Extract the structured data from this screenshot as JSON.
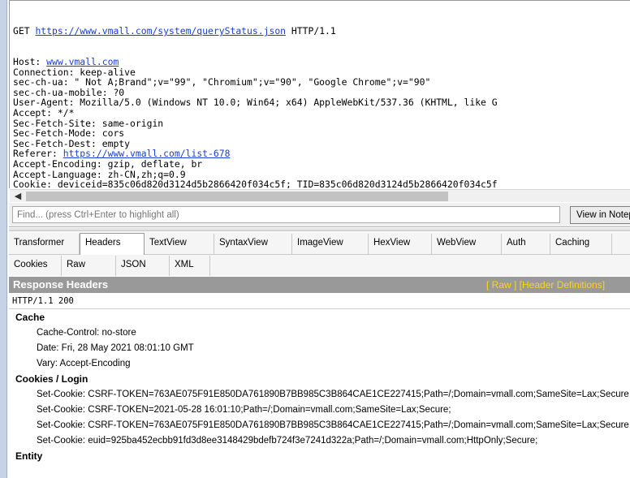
{
  "request": {
    "method": "GET",
    "url": "https://www.vmall.com/system/queryStatus.json",
    "protocol": "HTTP/1.1",
    "lines": [
      {
        "pre": "Host: ",
        "link": "www.vmall.com",
        "post": ""
      },
      {
        "pre": "Connection: keep-alive",
        "link": "",
        "post": ""
      },
      {
        "pre": "sec-ch-ua: \" Not A;Brand\";v=\"99\", \"Chromium\";v=\"90\", \"Google Chrome\";v=\"90\"",
        "link": "",
        "post": ""
      },
      {
        "pre": "sec-ch-ua-mobile: ?0",
        "link": "",
        "post": ""
      },
      {
        "pre": "User-Agent: Mozilla/5.0 (Windows NT 10.0; Win64; x64) AppleWebKit/537.36 (KHTML, like G",
        "link": "",
        "post": ""
      },
      {
        "pre": "Accept: */*",
        "link": "",
        "post": ""
      },
      {
        "pre": "Sec-Fetch-Site: same-origin",
        "link": "",
        "post": ""
      },
      {
        "pre": "Sec-Fetch-Mode: cors",
        "link": "",
        "post": ""
      },
      {
        "pre": "Sec-Fetch-Dest: empty",
        "link": "",
        "post": ""
      },
      {
        "pre": "Referer: ",
        "link": "https://www.vmall.com/list-678",
        "post": ""
      },
      {
        "pre": "Accept-Encoding: gzip, deflate, br",
        "link": "",
        "post": ""
      },
      {
        "pre": "Accept-Language: zh-CN,zh;q=0.9",
        "link": "",
        "post": ""
      },
      {
        "pre": "Cookie: deviceid=835c06d820d3124d5b2866420f034c5f; TID=835c06d820d3124d5b2866420f034c5f",
        "link": "",
        "post": ""
      }
    ]
  },
  "find": {
    "placeholder": "Find... (press Ctrl+Enter to highlight all)",
    "view_button": "View in Notepad"
  },
  "tabs_row1": [
    "Transformer",
    "Headers",
    "TextView",
    "SyntaxView",
    "ImageView",
    "HexView",
    "WebView",
    "Auth",
    "Caching"
  ],
  "tabs_row2": [
    "Cookies",
    "Raw",
    "JSON",
    "XML"
  ],
  "active_tab": "Headers",
  "response": {
    "title": "Response Headers",
    "links": "[ Raw ]   [Header Definitions]",
    "status_line": "HTTP/1.1 200",
    "groups": [
      {
        "name": "Cache",
        "headers": [
          "Cache-Control: no-store",
          "Date: Fri, 28 May 2021 08:01:10 GMT",
          "Vary: Accept-Encoding"
        ]
      },
      {
        "name": "Cookies / Login",
        "headers": [
          "Set-Cookie: CSRF-TOKEN=763AE075F91E850DA761890B7BB985C3B864CAE1CE227415;Path=/;Domain=vmall.com;SameSite=Lax;Secure;",
          "Set-Cookie: CSRF-TOKEN=2021-05-28 16:01:10;Path=/;Domain=vmall.com;SameSite=Lax;Secure;",
          "Set-Cookie: CSRF-TOKEN=763AE075F91E850DA761890B7BB985C3B864CAE1CE227415;Path=/;Domain=vmall.com;SameSite=Lax;Secure;",
          "Set-Cookie: euid=925ba452ecbb91fd3d8ee3148429bdefb724f3e7241d322a;Path=/;Domain=vmall.com;HttpOnly;Secure;"
        ]
      },
      {
        "name": "Entity",
        "headers": []
      }
    ]
  },
  "colors": {
    "link": "#1a3fd6",
    "title_bar": "#999999",
    "title_links": "#ffd21f",
    "left_edge": "#c6d3e6"
  }
}
